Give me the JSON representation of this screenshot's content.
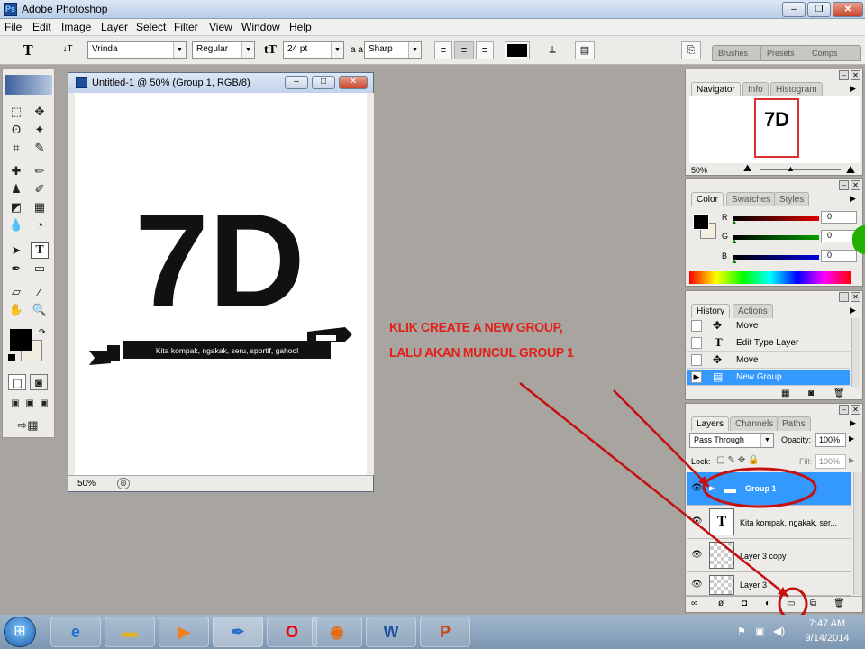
{
  "app": {
    "title": "Adobe Photoshop",
    "icon": "photoshop-icon",
    "icon_text": "Ps",
    "win_min": "–",
    "win_max": "❐",
    "win_close": "✕"
  },
  "menu": [
    "File",
    "Edit",
    "Image",
    "Layer",
    "Select",
    "Filter",
    "View",
    "Window",
    "Help"
  ],
  "options": {
    "tool_glyph": "T",
    "orient_glyph": "↓T",
    "font": "Vrinda",
    "style": "Regular",
    "size": "24 pt",
    "aa_label": "a a",
    "aa": "Sharp",
    "color": "#000000",
    "panel_tabs": [
      "Brushes",
      "Presets",
      "Comps"
    ]
  },
  "document": {
    "title": "Untitled-1 @ 50% (Group 1, RGB/8)",
    "zoom": "50%",
    "artwork_text": "7D",
    "banner_text": "Kita kompak, ngakak, seru, sportif, gahool"
  },
  "navigator": {
    "tabs": [
      "Navigator",
      "Info",
      "Histogram"
    ],
    "zoom": "50%",
    "thumb_text": "7D"
  },
  "color": {
    "tabs": [
      "Color",
      "Swatches",
      "Styles"
    ],
    "channels": [
      {
        "label": "R",
        "value": "0",
        "color": "#e00000"
      },
      {
        "label": "G",
        "value": "0",
        "color": "#00a000"
      },
      {
        "label": "B",
        "value": "0",
        "color": "#0000e0"
      }
    ]
  },
  "history": {
    "tabs": [
      "History",
      "Actions"
    ],
    "items": [
      "Move",
      "Edit Type Layer",
      "Move",
      "New Group"
    ]
  },
  "layers": {
    "tabs": [
      "Layers",
      "Channels",
      "Paths"
    ],
    "blend": "Pass Through",
    "opacity_label": "Opacity:",
    "opacity": "100%",
    "lock_label": "Lock:",
    "fill_label": "Fill:",
    "fill": "100%",
    "rows": [
      "Group 1",
      "Kita kompak, ngakak, ser...",
      "Layer 3 copy",
      "Layer 3"
    ]
  },
  "annotation": {
    "line1": "KLIK CREATE A NEW GROUP,",
    "line2": "LALU AKAN MUNCUL GROUP 1",
    "color": "#e0211a"
  },
  "taskbar": {
    "time": "7:47 AM",
    "date": "9/14/2014",
    "apps": [
      "ie-icon",
      "explorer-icon",
      "media-player-icon",
      "photoshop-icon",
      "opera-icon",
      "firefox-icon",
      "word-icon",
      "publisher-icon"
    ]
  }
}
